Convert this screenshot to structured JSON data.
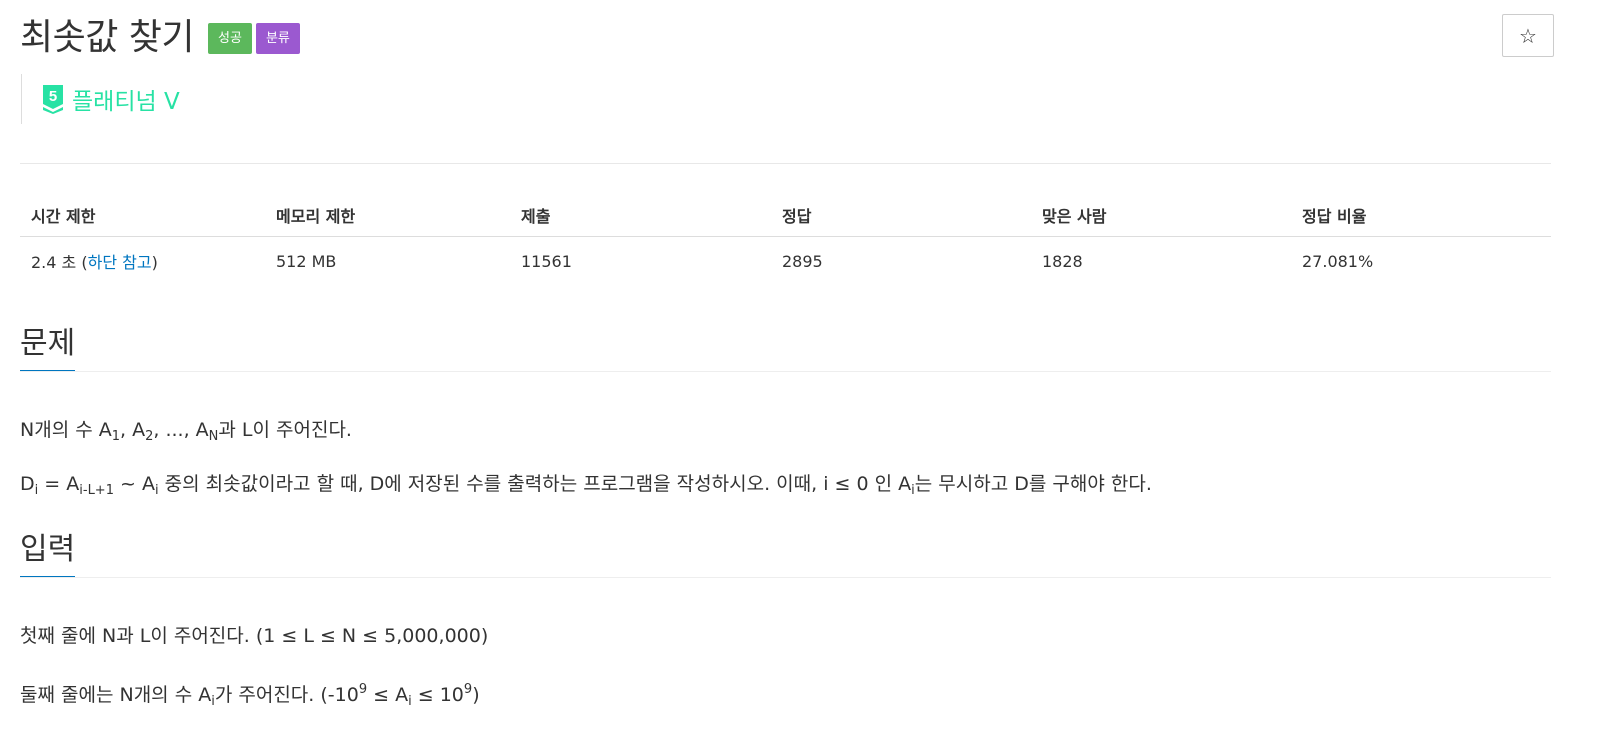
{
  "problem": {
    "title": "최솟값 찾기",
    "badges": {
      "success": "성공",
      "category": "분류"
    },
    "tier": {
      "level": "5",
      "label": "플래티넘 V",
      "color": "#27e2a4"
    },
    "star_icon": "☆"
  },
  "info_table": {
    "headers": {
      "time_limit": "시간 제한",
      "memory_limit": "메모리 제한",
      "submissions": "제출",
      "accepted": "정답",
      "solvers": "맞은 사람",
      "ratio": "정답 비율"
    },
    "row": {
      "time_limit_value": "2.4 초",
      "time_limit_paren_open": "(",
      "time_limit_link": "하단 참고",
      "time_limit_paren_close": ")",
      "memory_limit": "512 MB",
      "submissions": "11561",
      "accepted": "2895",
      "solvers": "1828",
      "ratio": "27.081%"
    }
  },
  "sections": {
    "problem_heading": "문제",
    "problem_p1": {
      "t1": "N개의 수 A",
      "s1": "1",
      "t2": ", A",
      "s2": "2",
      "t3": ", ..., A",
      "s3": "N",
      "t4": "과 L이 주어진다."
    },
    "problem_p2": {
      "t1": "D",
      "s1": "i",
      "t2": " = A",
      "s2": "i-L+1",
      "t3": " ~ A",
      "s3": "i",
      "t4": " 중의 최솟값이라고 할 때, D에 저장된 수를 출력하는 프로그램을 작성하시오. 이때, i ≤ 0 인 A",
      "s4": "i",
      "t5": "는 무시하고 D를 구해야 한다."
    },
    "input_heading": "입력",
    "input_p1": "첫째 줄에 N과 L이 주어진다. (1 ≤ L ≤ N ≤ 5,000,000)",
    "input_p2": {
      "t1": "둘째 줄에는 N개의 수 A",
      "s1": "i",
      "t2": "가 주어진다. (-10",
      "p1": "9",
      "t3": " ≤ A",
      "s2": "i",
      "t4": " ≤ 10",
      "p2": "9",
      "t5": ")"
    }
  },
  "colors": {
    "success": "#5cb85c",
    "category": "#9b59d0",
    "link": "#0076c0",
    "accent": "#0076c0",
    "tier": "#27e2a4"
  }
}
